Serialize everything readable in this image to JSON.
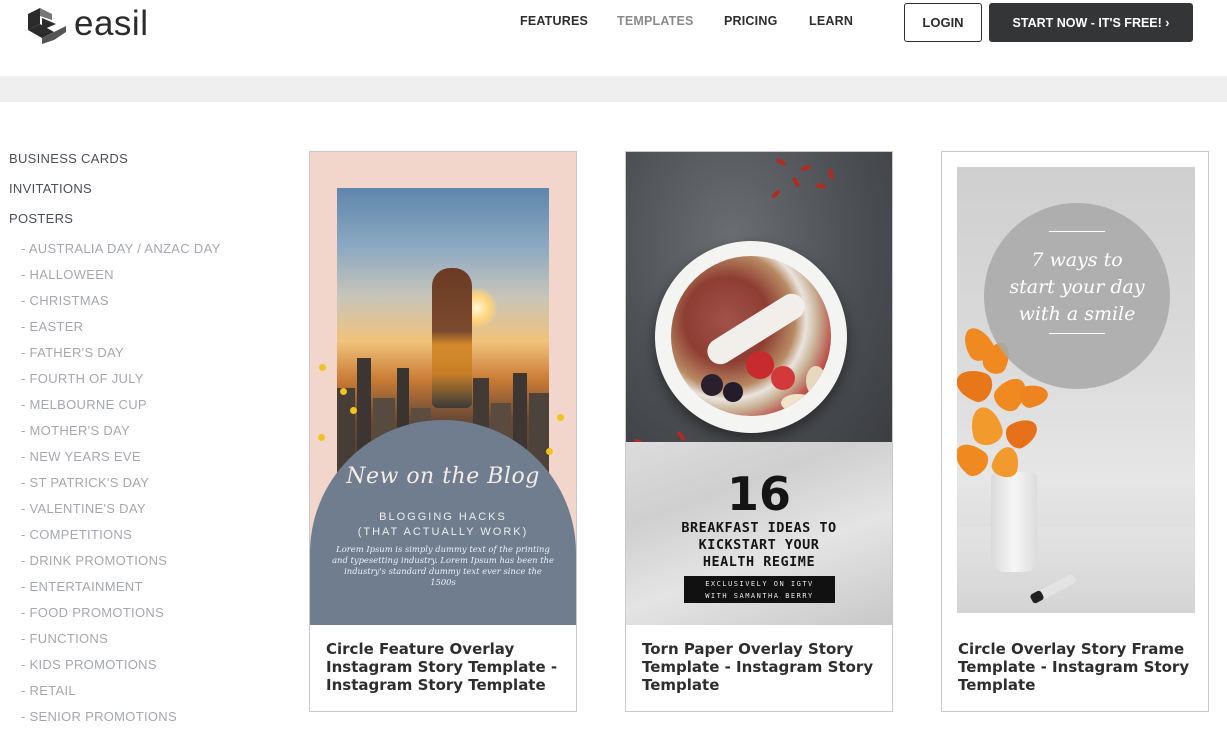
{
  "header": {
    "brand": "easil",
    "nav": [
      "FEATURES",
      "TEMPLATES",
      "PRICING",
      "LEARN"
    ],
    "login_label": "LOGIN",
    "start_label": "START NOW - IT'S FREE! ›"
  },
  "sidebar": {
    "main_items": [
      "BUSINESS CARDS",
      "INVITATIONS",
      "POSTERS"
    ],
    "sub_items": [
      "- AUSTRALIA DAY / ANZAC DAY",
      "- HALLOWEEN",
      "- CHRISTMAS",
      "- EASTER",
      "- FATHER'S DAY",
      "- FOURTH OF JULY",
      "- MELBOURNE CUP",
      "- MOTHER'S DAY",
      "- NEW YEARS EVE",
      "- ST PATRICK'S DAY",
      "- VALENTINE'S DAY",
      "- COMPETITIONS",
      "- DRINK PROMOTIONS",
      "- ENTERTAINMENT",
      "- FOOD PROMOTIONS",
      "- FUNCTIONS",
      "- KIDS PROMOTIONS",
      "- RETAIL",
      "- SENIOR PROMOTIONS"
    ]
  },
  "cards": [
    {
      "title": "Circle Feature Overlay Instagram Story Template - Instagram Story Template",
      "thumb": {
        "script": "New on the Blog",
        "heading_line1": "BLOGGING HACKS",
        "heading_line2": "(THAT ACTUALLY WORK)",
        "body": "Lorem Ipsum is simply dummy text of the printing and typesetting industry. Lorem Ipsum has been the industry's standard dummy text ever since the 1500s"
      }
    },
    {
      "title": "Torn Paper Overlay Story Template - Instagram Story Template",
      "thumb": {
        "number": "16",
        "heading_line1": "BREAKFAST IDEAS TO",
        "heading_line2": "KICKSTART YOUR",
        "heading_line3": "HEALTH REGIME",
        "tag_line1": "EXCLUSIVELY ON IGTV",
        "tag_line2": "WITH SAMANTHA BERRY"
      }
    },
    {
      "title": "Circle Overlay Story Frame Template - Instagram Story Template",
      "thumb": {
        "line1": "7 ways to",
        "line2": "start your day",
        "line3": "with a smile"
      }
    }
  ],
  "colors": {
    "dark_button": "#343536",
    "band": "#efeff0",
    "pink": "#f3d6cb",
    "slate": "#6f7d8f"
  }
}
